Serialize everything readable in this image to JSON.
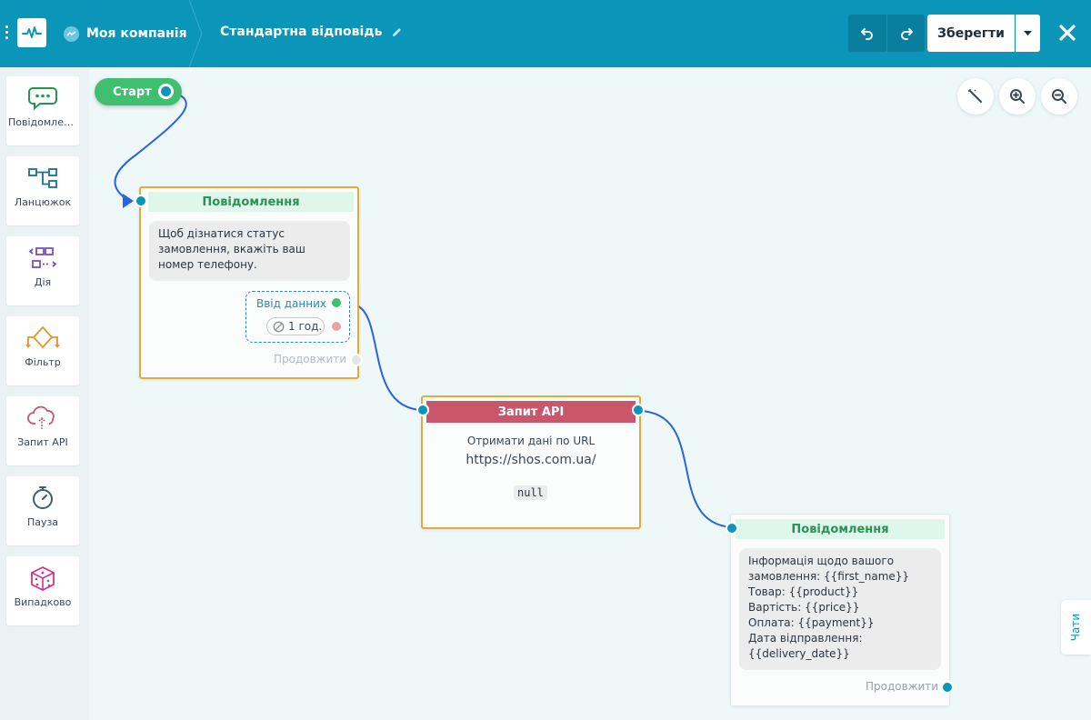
{
  "header": {
    "company": "Моя компанія",
    "flow_title": "Стандартна відповідь",
    "save_label": "Зберегти"
  },
  "sidebar": {
    "items": [
      {
        "label": "Повідомлення",
        "icon": "chat-bubble-icon"
      },
      {
        "label": "Ланцюжок",
        "icon": "chain-icon"
      },
      {
        "label": "Дія",
        "icon": "action-icon"
      },
      {
        "label": "Фільтр",
        "icon": "filter-icon"
      },
      {
        "label": "Запит API",
        "icon": "api-cloud-icon"
      },
      {
        "label": "Пауза",
        "icon": "stopwatch-icon"
      },
      {
        "label": "Випадково",
        "icon": "dice-icon"
      }
    ]
  },
  "canvas": {
    "start_label": "Старт",
    "node1": {
      "title": "Повідомлення",
      "text": "Щоб дізнатися статус замовлення, вкажіть ваш номер телефону.",
      "input_label": "Ввід данних",
      "timeout": "1 год.",
      "continue": "Продовжити"
    },
    "node2": {
      "title": "Запит API",
      "subtitle": "Отримати дані по URL",
      "url": "https://shos.com.ua/",
      "result": "null"
    },
    "node3": {
      "title": "Повідомлення",
      "lines": [
        "Інформація щодо вашого",
        "замовлення: {{first_name}}",
        "Товар: {{product}}",
        "Вартість: {{price}}",
        "Оплата: {{payment}}",
        "Дата відправлення:",
        "{{delivery_date}}"
      ],
      "continue": "Продовжити"
    }
  },
  "chats_tab": "Чати",
  "colors": {
    "header": "#0b95b8",
    "canvas": "#eef8f8",
    "selected_border": "#e8a93b",
    "green": "#3fbf6f",
    "api_red": "#c9566a",
    "connector": "#2a63e0"
  }
}
